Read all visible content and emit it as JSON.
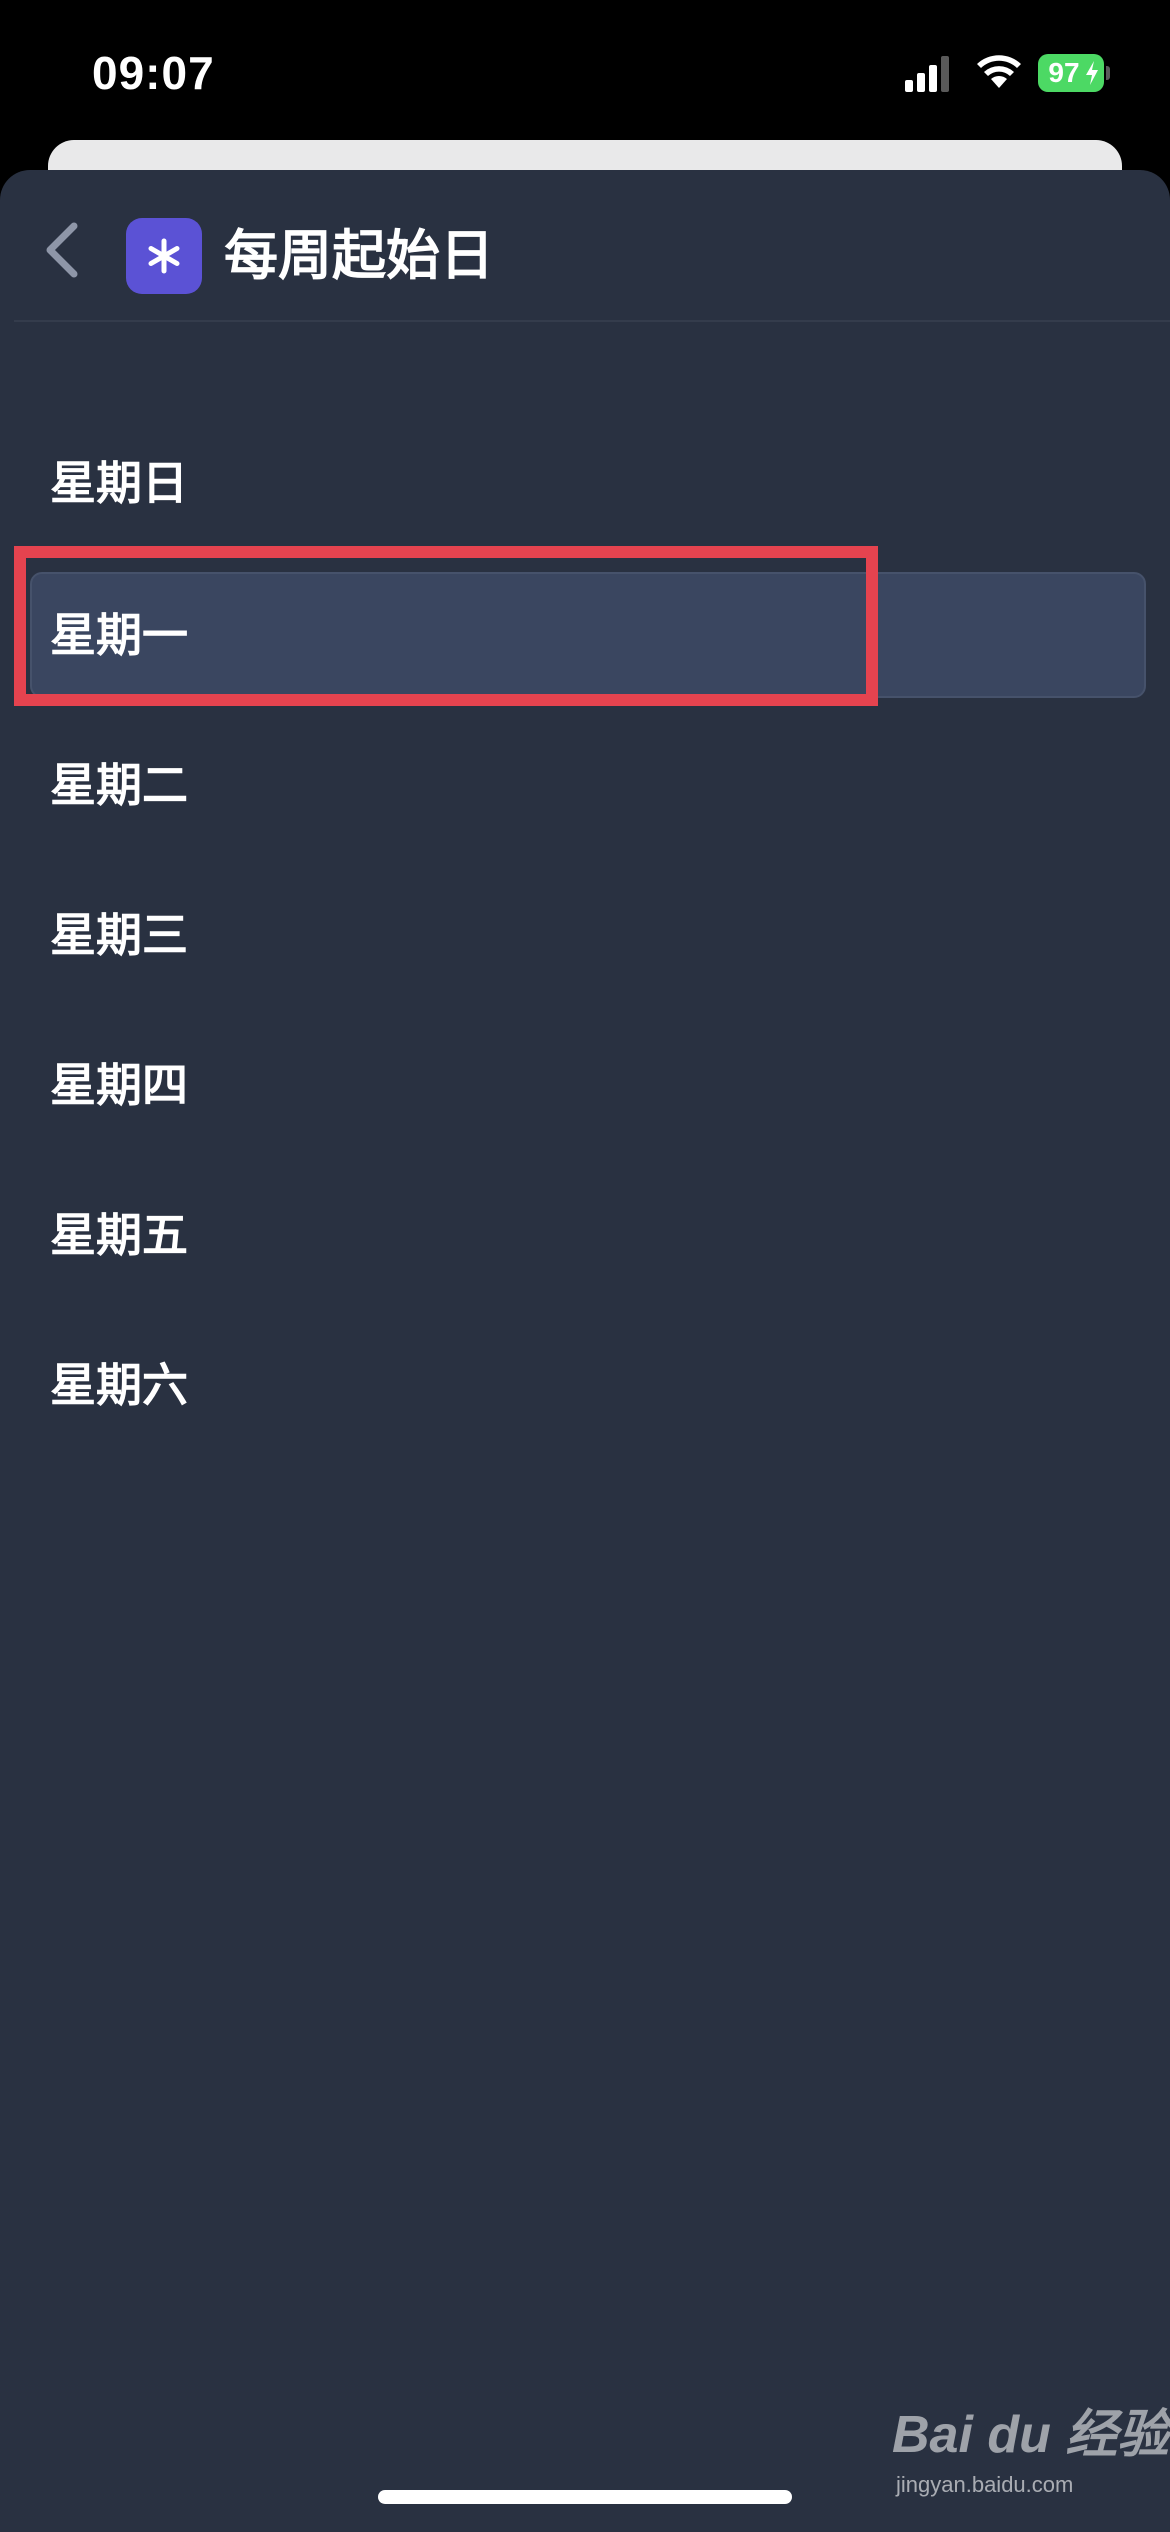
{
  "status_bar": {
    "time": "09:07",
    "battery_level": "97",
    "charging": true,
    "icons": [
      "signal-icon",
      "wifi-icon",
      "battery-icon",
      "charging-bolt-icon"
    ]
  },
  "nav": {
    "back_icon": "chevron-left-icon",
    "app_icon": "asterisk-icon",
    "app_icon_color": "#5b52d5",
    "title": "每周起始日"
  },
  "options": [
    {
      "label": "星期日",
      "selected": false
    },
    {
      "label": "星期一",
      "selected": true
    },
    {
      "label": "星期二",
      "selected": false
    },
    {
      "label": "星期三",
      "selected": false
    },
    {
      "label": "星期四",
      "selected": false
    },
    {
      "label": "星期五",
      "selected": false
    },
    {
      "label": "星期六",
      "selected": false
    }
  ],
  "colors": {
    "sheet_background": "#293141",
    "selected_row": "#3a4660",
    "annotation_red": "#e5434f",
    "battery_green": "#4cd964"
  },
  "watermark": {
    "logo": "Bai du 经验",
    "url": "jingyan.baidu.com"
  }
}
